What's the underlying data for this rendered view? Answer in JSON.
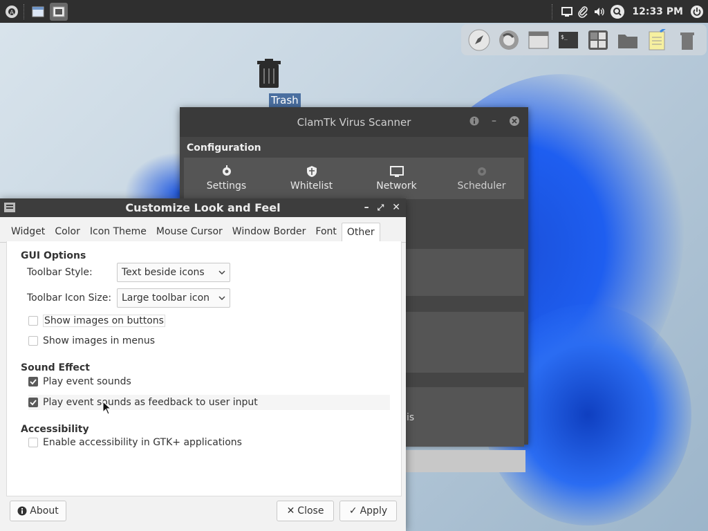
{
  "top_panel": {
    "clock": "12:33 PM"
  },
  "desktop": {
    "trash_label": "Trash"
  },
  "clamtk": {
    "title": "ClamTk Virus Scanner",
    "section": "Configuration",
    "items": [
      {
        "label": "Settings"
      },
      {
        "label": "Whitelist"
      },
      {
        "label": "Network"
      },
      {
        "label": "Scheduler"
      }
    ],
    "partial_text": "is"
  },
  "customize": {
    "title": "Customize Look and Feel",
    "tabs": [
      {
        "label": "Widget"
      },
      {
        "label": "Color"
      },
      {
        "label": "Icon Theme"
      },
      {
        "label": "Mouse Cursor"
      },
      {
        "label": "Window Border"
      },
      {
        "label": "Font"
      },
      {
        "label": "Other"
      }
    ],
    "gui_options": {
      "heading": "GUI Options",
      "toolbar_style_label": "Toolbar Style:",
      "toolbar_style_value": "Text beside icons",
      "toolbar_icon_size_label": "Toolbar Icon Size:",
      "toolbar_icon_size_value": "Large toolbar icon",
      "show_images_buttons": "Show images on buttons",
      "show_images_menus": "Show images in menus"
    },
    "sound_effect": {
      "heading": "Sound Effect",
      "play_event_sounds": "Play event sounds",
      "play_feedback_sounds": "Play event sounds as feedback to user input"
    },
    "accessibility": {
      "heading": "Accessibility",
      "enable_gtk": "Enable accessibility in GTK+ applications"
    },
    "buttons": {
      "about": "About",
      "close": "Close",
      "apply": "Apply"
    }
  },
  "colors": {
    "panel_bg": "#2f2f2f",
    "window_title_bg": "#3d3d3d",
    "selection_bg": "#4a6fa0"
  }
}
